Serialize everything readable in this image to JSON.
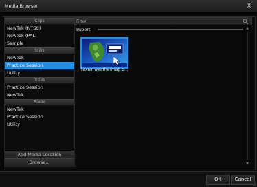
{
  "window": {
    "title": "Media Browser",
    "close_label": "X"
  },
  "sidebar": {
    "sections": [
      {
        "header": "Clips",
        "items": [
          "NewTek (NTSC)",
          "NewTek (PAL)",
          "Sample"
        ]
      },
      {
        "header": "Stills",
        "items": [
          "NewTek",
          "Practice Session",
          "Utility"
        ],
        "selected": "Practice Session"
      },
      {
        "header": "Titles",
        "items": [
          "Practice Session",
          "NewTek"
        ]
      },
      {
        "header": "Audio",
        "items": [
          "NewTek",
          "Practice Session",
          "Utility"
        ]
      }
    ],
    "add_location_label": "Add Media Location",
    "browse_label": "Browse..."
  },
  "main": {
    "filter_placeholder": "Filter",
    "group_label": "Import",
    "items": [
      {
        "label": "texas_weathermap.p..."
      }
    ]
  },
  "footer": {
    "ok_label": "OK",
    "cancel_label": "Cancel"
  },
  "colors": {
    "accent": "#1e8fe8",
    "background": "#0b0b0b",
    "header": "#2e2e2e"
  }
}
